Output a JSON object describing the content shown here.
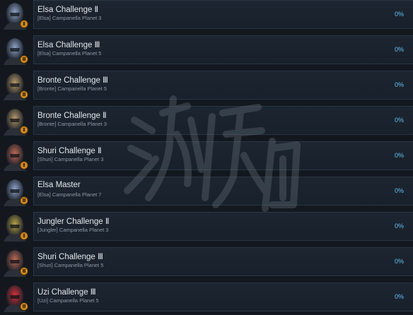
{
  "achievements": [
    {
      "name": "Elsa Challenge Ⅱ",
      "desc": "[Elsa] Campanella Planet 3",
      "pct": "0%",
      "icon": "elsa-portrait-icon",
      "tint": "#8fa4c8",
      "badge": "Ⅱ"
    },
    {
      "name": "Elsa Challenge Ⅲ",
      "desc": "[Elsa] Campanella Planet 5",
      "pct": "0%",
      "icon": "elsa-portrait-icon",
      "tint": "#8fa4c8",
      "badge": "Ⅲ"
    },
    {
      "name": "Bronte Challenge Ⅲ",
      "desc": "[Bronte] Campanella Planet 5",
      "pct": "0%",
      "icon": "bronte-portrait-icon",
      "tint": "#b79a6a",
      "badge": "Ⅲ"
    },
    {
      "name": "Bronte Challenge Ⅱ",
      "desc": "[Bronte] Campanella Planet 3",
      "pct": "0%",
      "icon": "bronte-portrait-icon",
      "tint": "#b79a6a",
      "badge": "Ⅱ"
    },
    {
      "name": "Shuri Challenge Ⅱ",
      "desc": "[Shuri] Campanella Planet 3",
      "pct": "0%",
      "icon": "shuri-portrait-icon",
      "tint": "#c06a55",
      "badge": "Ⅱ"
    },
    {
      "name": "Elsa Master",
      "desc": "[Elsa] Campanella Planet 7",
      "pct": "0%",
      "icon": "elsa-portrait-icon",
      "tint": "#8fa4c8",
      "badge": "Ⅲ"
    },
    {
      "name": "Jungler Challenge Ⅱ",
      "desc": "[Jungler] Campanella Planet 3",
      "pct": "0%",
      "icon": "jungler-portrait-icon",
      "tint": "#b8a24a",
      "badge": "Ⅱ"
    },
    {
      "name": "Shuri Challenge Ⅲ",
      "desc": "[Shuri] Campanella Planet 5",
      "pct": "0%",
      "icon": "shuri-portrait-icon",
      "tint": "#c06a55",
      "badge": "Ⅲ"
    },
    {
      "name": "Uzi Challenge Ⅲ",
      "desc": "[Uzi] Campanella Planet 5",
      "pct": "0%",
      "icon": "uzi-portrait-icon",
      "tint": "#d0303a",
      "badge": "Ⅲ"
    }
  ],
  "colors": {
    "background": "#13181f",
    "panel": "#1c2530",
    "title": "#e4e9ee",
    "subtitle": "#8c99a6",
    "percent": "#67c1f5",
    "badge": "#d28a1e"
  },
  "watermark": {
    "text": "游侠网"
  }
}
